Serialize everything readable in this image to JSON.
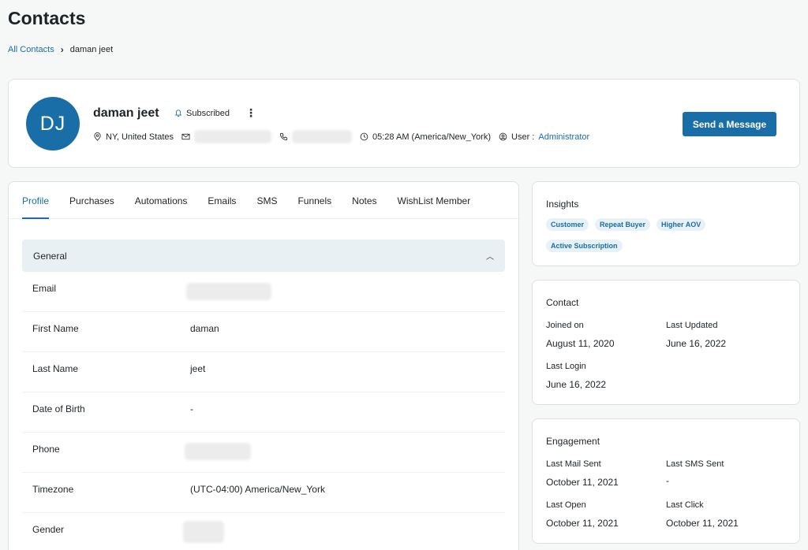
{
  "page": {
    "title": "Contacts"
  },
  "breadcrumb": {
    "root": "All Contacts",
    "separator": "›",
    "current": "daman jeet"
  },
  "header": {
    "initials": "DJ",
    "name": "daman jeet",
    "status": "Subscribed",
    "more": "⋮",
    "location": "NY, United States",
    "time": "05:28 AM (America/New_York)",
    "user_label": "User :",
    "user_role": "Administrator",
    "send_button": "Send a Message",
    "accent_color": "#1a6ea8"
  },
  "tabs": [
    "Profile",
    "Purchases",
    "Automations",
    "Emails",
    "SMS",
    "Funnels",
    "Notes",
    "WishList Member"
  ],
  "general": {
    "title": "General",
    "fields": [
      {
        "label": "Email",
        "value": ""
      },
      {
        "label": "First Name",
        "value": "daman"
      },
      {
        "label": "Last Name",
        "value": "jeet"
      },
      {
        "label": "Date of Birth",
        "value": "-"
      },
      {
        "label": "Phone",
        "value": ""
      },
      {
        "label": "Timezone",
        "value": "(UTC-04:00) America/New_York"
      },
      {
        "label": "Gender",
        "value": ""
      }
    ]
  },
  "insights": {
    "title": "Insights",
    "badges": [
      "Customer",
      "Repeat Buyer",
      "Higher AOV",
      "Active Subscription"
    ]
  },
  "contact_info": {
    "title": "Contact",
    "joined_label": "Joined on",
    "joined_value": "August 11, 2020",
    "updated_label": "Last Updated",
    "updated_value": "June 16, 2022",
    "login_label": "Last Login",
    "login_value": "June 16, 2022"
  },
  "engagement": {
    "title": "Engagement",
    "mail_label": "Last Mail Sent",
    "mail_value": "October 11, 2021",
    "sms_label": "Last SMS Sent",
    "sms_value": "-",
    "open_label": "Last Open",
    "open_value": "October 11, 2021",
    "click_label": "Last Click",
    "click_value": "October 11, 2021"
  }
}
